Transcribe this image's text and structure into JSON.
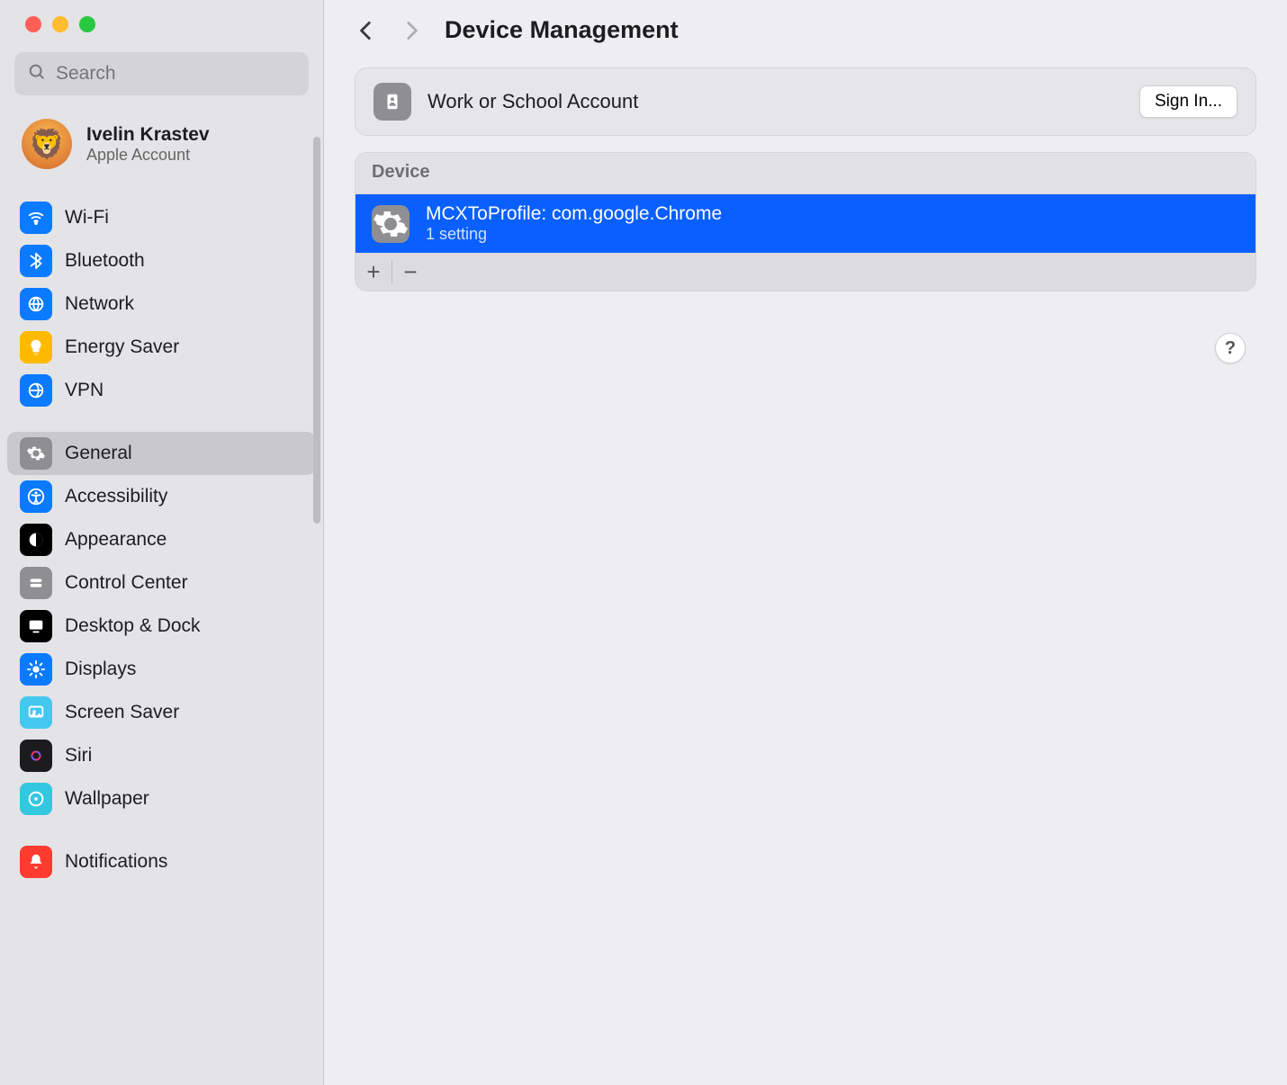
{
  "sidebar": {
    "search_placeholder": "Search",
    "account": {
      "name": "Ivelin Krastev",
      "subtitle": "Apple Account",
      "avatar_emoji": "🦁"
    },
    "groups": [
      {
        "items": [
          {
            "id": "wifi",
            "label": "Wi-Fi",
            "color": "#0a7aff",
            "icon": "wifi"
          },
          {
            "id": "bluetooth",
            "label": "Bluetooth",
            "color": "#0a7aff",
            "icon": "bluetooth"
          },
          {
            "id": "network",
            "label": "Network",
            "color": "#0a7aff",
            "icon": "globe"
          },
          {
            "id": "energy",
            "label": "Energy Saver",
            "color": "#ffba00",
            "icon": "bulb"
          },
          {
            "id": "vpn",
            "label": "VPN",
            "color": "#0a7aff",
            "icon": "vpn"
          }
        ]
      },
      {
        "items": [
          {
            "id": "general",
            "label": "General",
            "color": "#8e8e93",
            "icon": "gear",
            "selected": true
          },
          {
            "id": "accessibility",
            "label": "Accessibility",
            "color": "#0a7aff",
            "icon": "a11y"
          },
          {
            "id": "appearance",
            "label": "Appearance",
            "color": "#000000",
            "icon": "appearance"
          },
          {
            "id": "controlcenter",
            "label": "Control Center",
            "color": "#8e8e93",
            "icon": "cc"
          },
          {
            "id": "desktop",
            "label": "Desktop & Dock",
            "color": "#000000",
            "icon": "desktop"
          },
          {
            "id": "displays",
            "label": "Displays",
            "color": "#0a7aff",
            "icon": "displays"
          },
          {
            "id": "screensaver",
            "label": "Screen Saver",
            "color": "#44c8ef",
            "icon": "screensaver"
          },
          {
            "id": "siri",
            "label": "Siri",
            "color": "#1c1c1e",
            "icon": "siri"
          },
          {
            "id": "wallpaper",
            "label": "Wallpaper",
            "color": "#34c8e0",
            "icon": "wallpaper"
          }
        ]
      },
      {
        "items": [
          {
            "id": "notifications",
            "label": "Notifications",
            "color": "#ff3b30",
            "icon": "bell"
          }
        ]
      }
    ]
  },
  "main": {
    "title": "Device Management",
    "work_school": {
      "label": "Work or School Account",
      "signin_label": "Sign In..."
    },
    "device_section": {
      "header": "Device",
      "profiles": [
        {
          "name": "MCXToProfile: com.google.Chrome",
          "subtitle": "1 setting",
          "selected": true
        }
      ],
      "add_label": "+",
      "remove_label": "−"
    },
    "help_label": "?"
  }
}
